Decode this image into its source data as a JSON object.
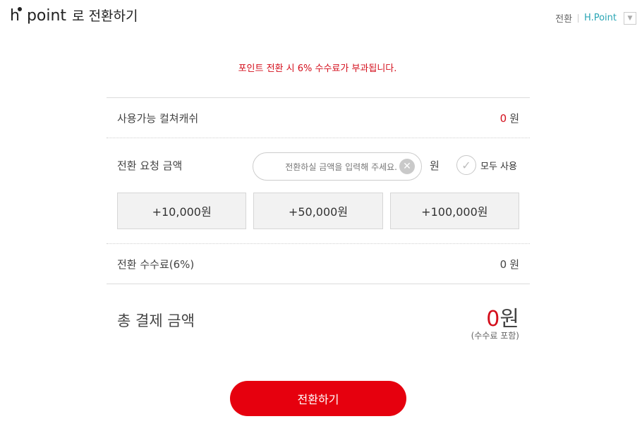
{
  "header": {
    "logo_h": "h",
    "logo_word": "point",
    "logo_suffix": "로 전환하기",
    "link_convert": "전환",
    "brand_link": "H.Point",
    "dropdown_glyph": "▼"
  },
  "notice": "포인트 전환 시 6% 수수료가 부과됩니다.",
  "available": {
    "label": "사용가능 컬쳐캐쉬",
    "value": "0",
    "unit": "원"
  },
  "request": {
    "label": "전환 요청 금액",
    "placeholder": "전환하실 금액을 입력해 주세요.",
    "value": "",
    "clear_glyph": "✕",
    "unit": "원",
    "use_all_label": "모두 사용",
    "use_all_checked": false,
    "check_glyph": "✓"
  },
  "quick_add": [
    {
      "label": "+10,000원"
    },
    {
      "label": "+50,000원"
    },
    {
      "label": "+100,000원"
    }
  ],
  "fee": {
    "label": "전환 수수료(6%)",
    "value": "0",
    "unit": "원"
  },
  "total": {
    "label": "총 결제 금액",
    "value": "0",
    "unit": "원",
    "note": "(수수료 포함)"
  },
  "submit_label": "전환하기",
  "colors": {
    "accent_red": "#e6000e",
    "notice_red": "#d40f1c",
    "brand_teal": "#2aa6b5"
  }
}
